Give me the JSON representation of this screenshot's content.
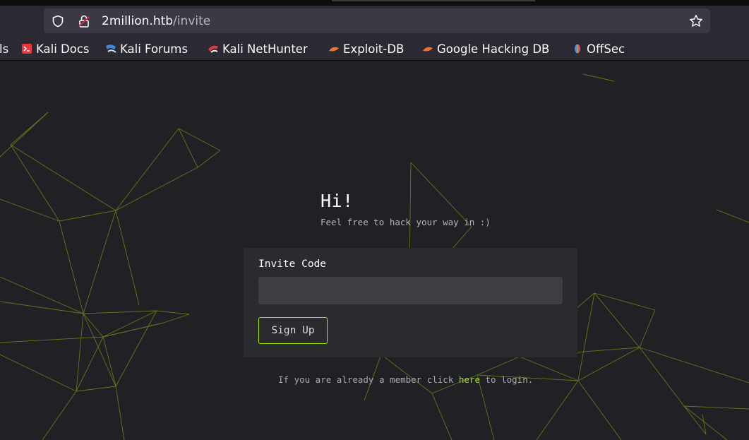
{
  "browser": {
    "url": {
      "host": "2million.htb",
      "path": "/invite"
    },
    "bookmarks": [
      {
        "label": "ls",
        "icon": "truncated-bookmark"
      },
      {
        "label": "Kali Docs",
        "icon": "kali-docs-icon"
      },
      {
        "label": "Kali Forums",
        "icon": "kali-forums-icon"
      },
      {
        "label": "Kali NetHunter",
        "icon": "kali-nethunter-icon"
      },
      {
        "label": "Exploit-DB",
        "icon": "exploit-db-icon"
      },
      {
        "label": "Google Hacking DB",
        "icon": "google-hacking-db-icon"
      },
      {
        "label": "OffSec",
        "icon": "offsec-icon"
      }
    ]
  },
  "page": {
    "title": "Hi!",
    "subtitle": "Feel free to hack your way in :)",
    "form": {
      "label": "Invite Code",
      "input_value": "",
      "submit_label": "Sign Up"
    },
    "login_prompt": {
      "before": "If you are already a member click ",
      "link": "here",
      "after": " to login."
    }
  },
  "colors": {
    "background": "#202124",
    "card": "#2a2b2f",
    "accent": "#9fef00",
    "network_lines": "#6b7f1c"
  }
}
